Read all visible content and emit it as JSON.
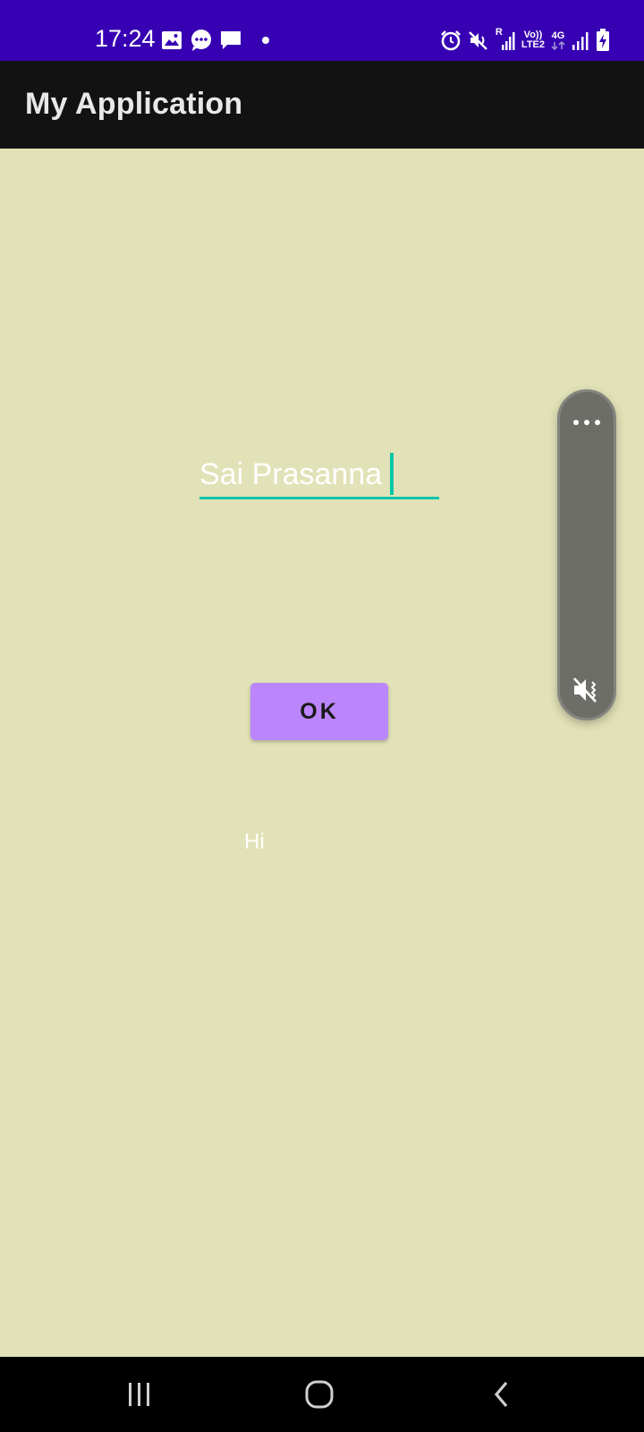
{
  "status_bar": {
    "time": "17:24",
    "left_icons": [
      "image-icon",
      "messages-icon",
      "chat-icon",
      "dot-icon"
    ],
    "right_icons": [
      "alarm-icon",
      "mute-icon",
      "signal-r-icon",
      "volte-icon",
      "4g-icon",
      "signal-icon",
      "battery-charging-icon"
    ],
    "roaming_label": "R",
    "volte_label_top": "Vo))",
    "volte_label_bottom": "LTE2",
    "network_label": "4G",
    "background_color": "#3700b3"
  },
  "app_bar": {
    "title": "My Application",
    "background_color": "#121212"
  },
  "main": {
    "background_color": "#e2e2b8",
    "name_field": {
      "value": "Sai Prasanna",
      "accent_color": "#03c5a8"
    },
    "ok_button": {
      "label": "OK",
      "color": "#bb86fc"
    },
    "result_text": "Hi"
  },
  "volume_panel": {
    "top_icon": "more-horizontal-icon",
    "bottom_icon": "volume-mute-icon"
  },
  "nav_bar": {
    "items": [
      "recents-icon",
      "home-icon",
      "back-icon"
    ]
  }
}
